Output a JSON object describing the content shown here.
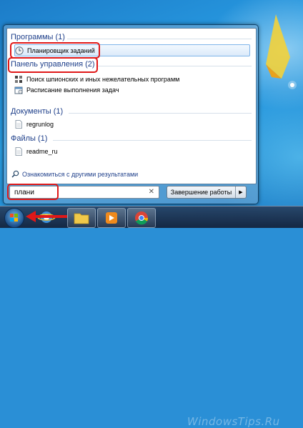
{
  "start_menu": {
    "groups": [
      {
        "header": "Программы (1)",
        "items": [
          {
            "label": "Планировщик заданий",
            "icon": "clock-icon"
          }
        ]
      },
      {
        "header": "Панель управления (2)",
        "items": [
          {
            "label": "Поиск шпионских и иных нежелательных программ",
            "icon": "defender-icon"
          },
          {
            "label": "Расписание выполнения задач",
            "icon": "schedule-icon"
          }
        ]
      },
      {
        "header": "Документы (1)",
        "items": [
          {
            "label": "regrunlog",
            "icon": "document-icon"
          }
        ]
      },
      {
        "header": "Файлы (1)",
        "items": [
          {
            "label": "readme_ru",
            "icon": "document-icon"
          }
        ]
      }
    ],
    "more_results": "Ознакомиться с другими результатами",
    "search": {
      "value": "плани"
    },
    "shutdown_label": "Завершение работы"
  },
  "taskbar": {
    "watermark": "WindowsTips.Ru"
  },
  "colors": {
    "highlight": "#e01818",
    "group_header": "#1e3f8a",
    "selected_bg": "#dbeafa"
  }
}
